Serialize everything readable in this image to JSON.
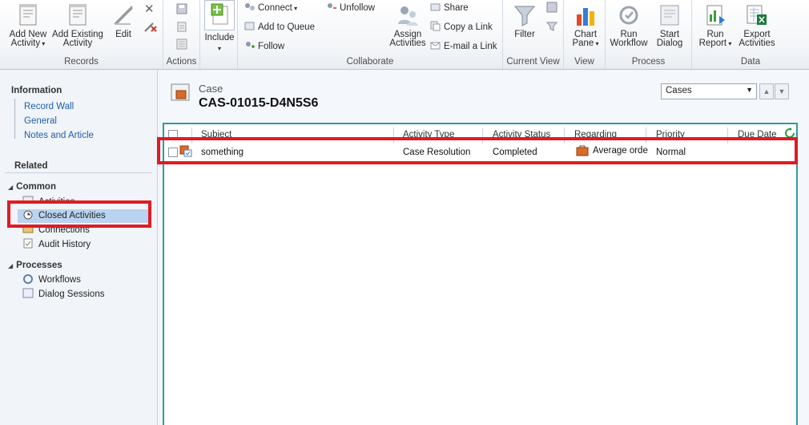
{
  "ribbon": {
    "records": {
      "label": "Records",
      "add_new": "Add New Activity",
      "add_existing": "Add Existing Activity",
      "edit": "Edit"
    },
    "actions": {
      "label": "Actions",
      "include": "Include"
    },
    "collaborate": {
      "label": "Collaborate",
      "connect": "Connect",
      "add_to_queue": "Add to Queue",
      "follow": "Follow",
      "unfollow": "Unfollow",
      "assign": "Assign Activities",
      "share": "Share",
      "copy_link": "Copy a Link",
      "email_link": "E-mail a Link"
    },
    "current_view": {
      "label": "Current View",
      "filter": "Filter"
    },
    "view": {
      "label": "View",
      "chart_pane": "Chart Pane"
    },
    "process": {
      "label": "Process",
      "run_workflow": "Run Workflow",
      "start_dialog": "Start Dialog"
    },
    "data": {
      "label": "Data",
      "run_report": "Run Report",
      "export_activities": "Export Activities"
    }
  },
  "leftnav": {
    "information_header": "Information",
    "information_items": [
      "Record Wall",
      "General",
      "Notes and Article"
    ],
    "related_header": "Related",
    "common_header": "Common",
    "common_items": [
      "Activities",
      "Closed Activities",
      "Connections",
      "Audit History"
    ],
    "processes_header": "Processes",
    "processes_items": [
      "Workflows",
      "Dialog Sessions"
    ]
  },
  "record": {
    "entity": "Case",
    "id": "CAS-01015-D4N5S6",
    "view_selector": "Cases"
  },
  "grid": {
    "columns": [
      "Subject",
      "Activity Type",
      "Activity Status",
      "Regarding",
      "Priority",
      "Due Date"
    ],
    "rows": [
      {
        "subject": "something",
        "activity_type": "Case Resolution",
        "activity_status": "Completed",
        "regarding": "Average orde",
        "priority": "Normal",
        "due_date": ""
      }
    ]
  },
  "colors": {
    "highlight": "#e01b24",
    "grid_border": "#2f9aa7",
    "link": "#1f5fa8",
    "selection": "#b9d3f0"
  }
}
